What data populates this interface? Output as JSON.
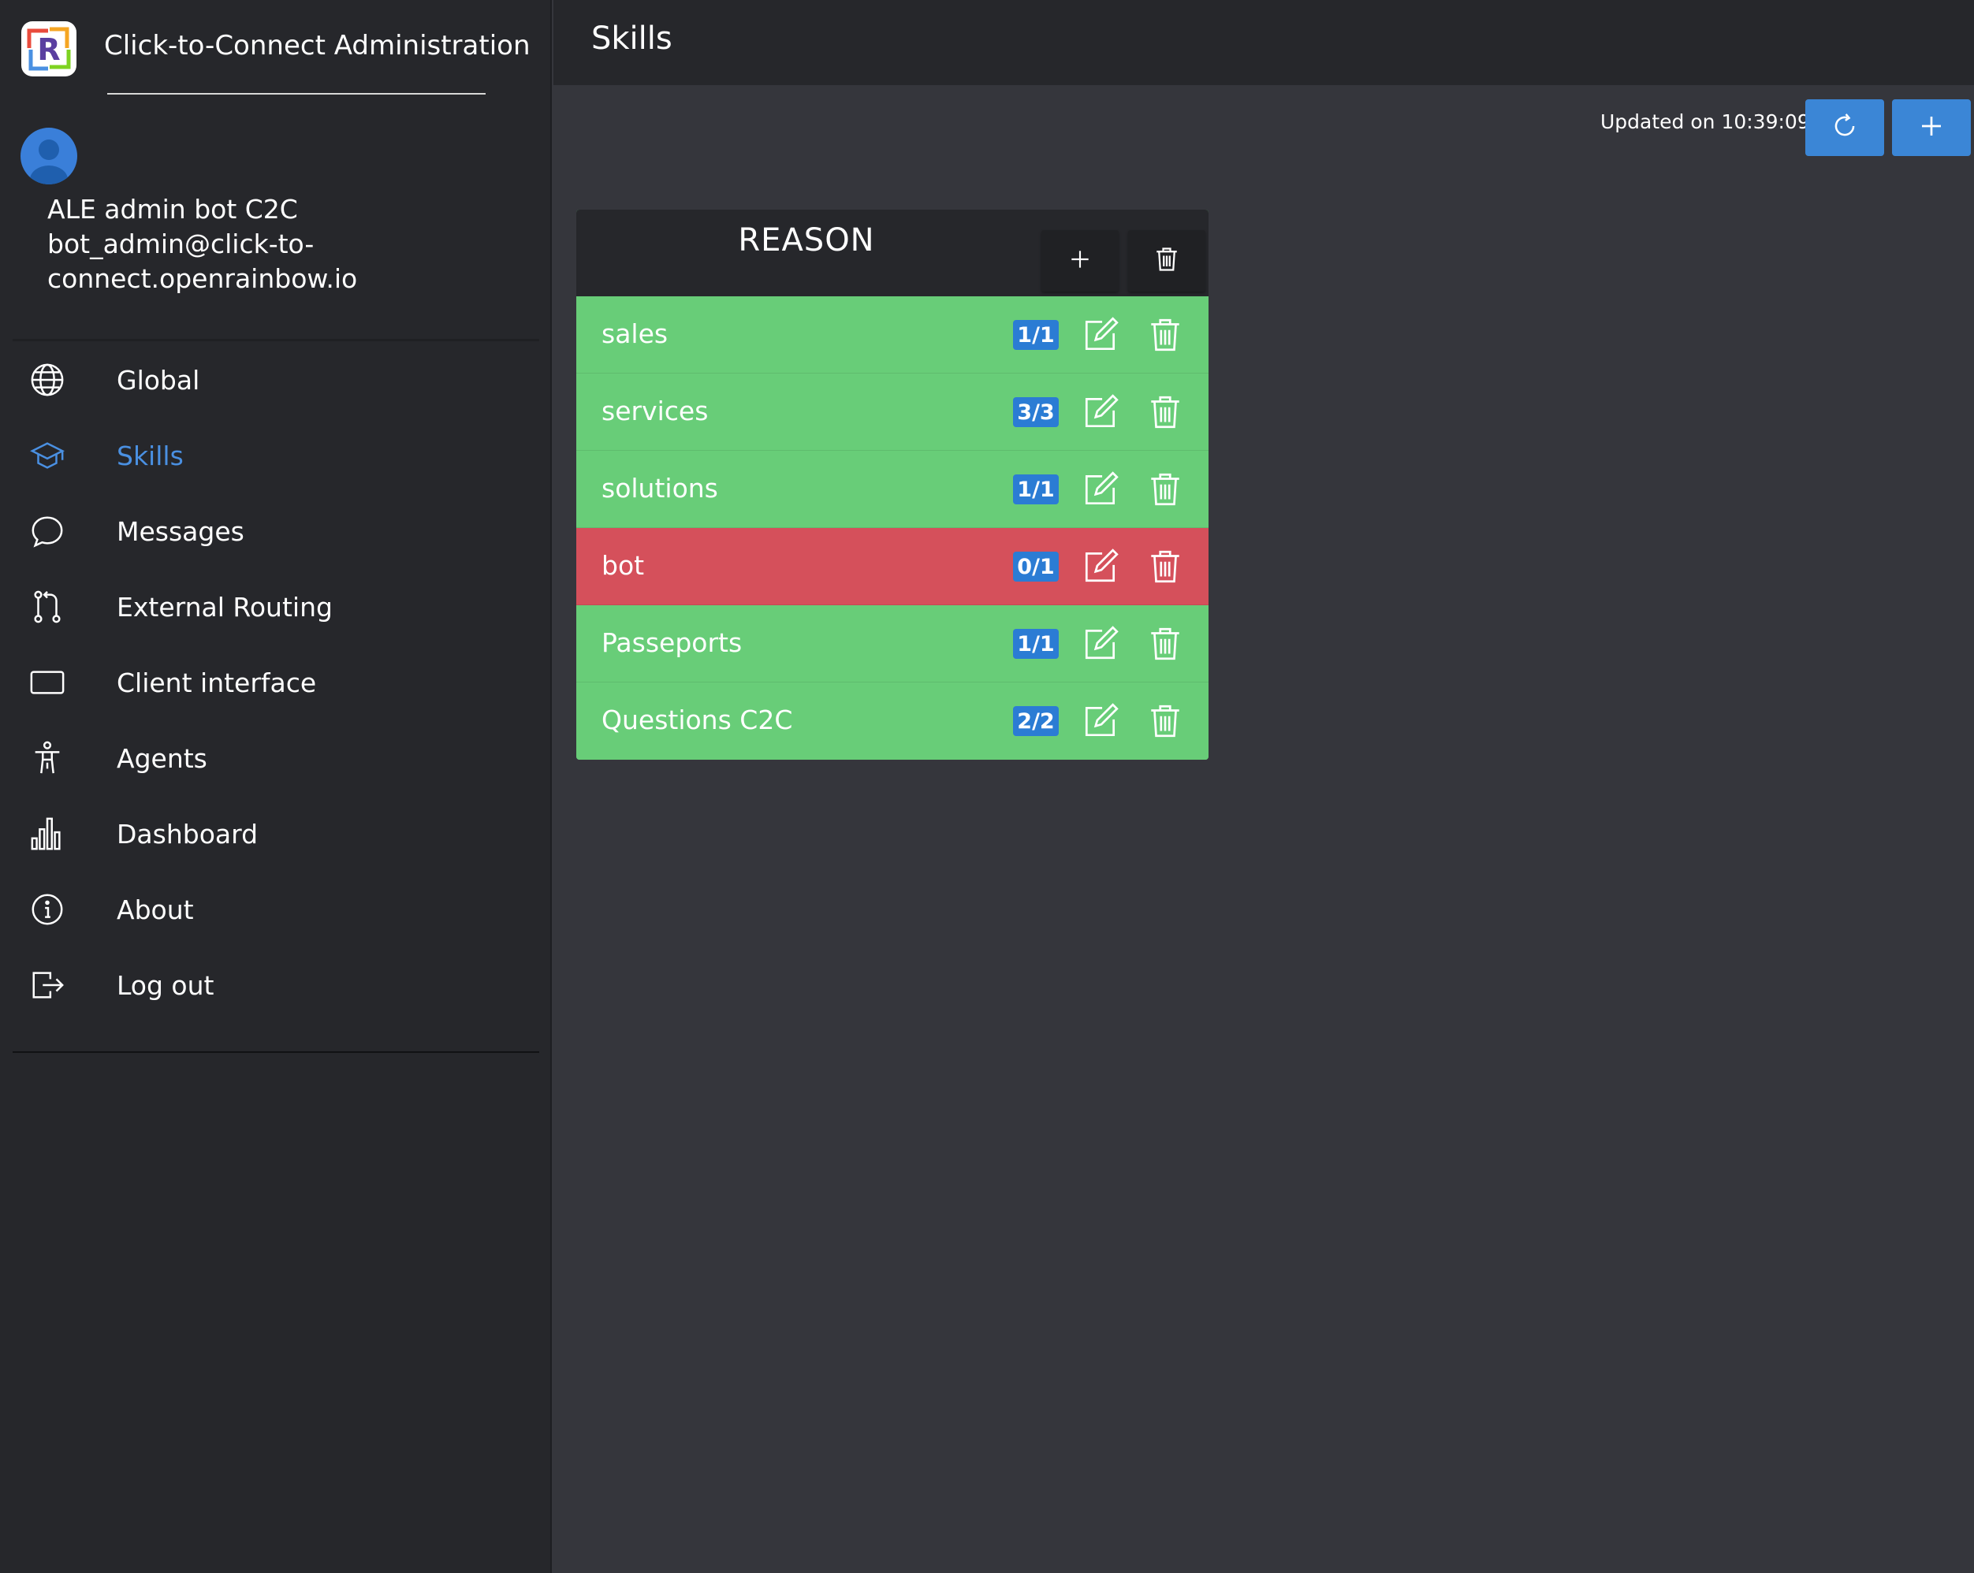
{
  "sidebar": {
    "brand_title": "Click-to-Connect Administration",
    "logo_letter": "R",
    "user": {
      "name": "ALE admin bot C2C",
      "email": "bot_admin@click-to-connect.openrainbow.io"
    },
    "items": [
      {
        "label": "Global",
        "icon": "globe-icon"
      },
      {
        "label": "Skills",
        "icon": "graduation-cap-icon",
        "active": true
      },
      {
        "label": "Messages",
        "icon": "chat-bubble-icon"
      },
      {
        "label": "External Routing",
        "icon": "routing-icon"
      },
      {
        "label": "Client interface",
        "icon": "screen-icon"
      },
      {
        "label": "Agents",
        "icon": "person-icon"
      },
      {
        "label": "Dashboard",
        "icon": "bar-chart-icon"
      },
      {
        "label": "About",
        "icon": "info-icon"
      },
      {
        "label": "Log out",
        "icon": "logout-icon"
      }
    ]
  },
  "header": {
    "title": "Skills",
    "updated_text": "Updated on 10:39:09"
  },
  "card": {
    "title": "REASON",
    "rows": [
      {
        "label": "sales",
        "count": "1/1",
        "status": "green"
      },
      {
        "label": "services",
        "count": "3/3",
        "status": "green"
      },
      {
        "label": "solutions",
        "count": "1/1",
        "status": "green"
      },
      {
        "label": "bot",
        "count": "0/1",
        "status": "red"
      },
      {
        "label": "Passeports",
        "count": "1/1",
        "status": "green"
      },
      {
        "label": "Questions C2C",
        "count": "2/2",
        "status": "green"
      }
    ]
  },
  "colors": {
    "accent": "#3b86d6",
    "active_nav": "#4a90e2",
    "ok_row": "#68cd78",
    "error_row": "#d5505b",
    "sidebar_bg": "#26272b",
    "main_bg": "#35363c"
  }
}
